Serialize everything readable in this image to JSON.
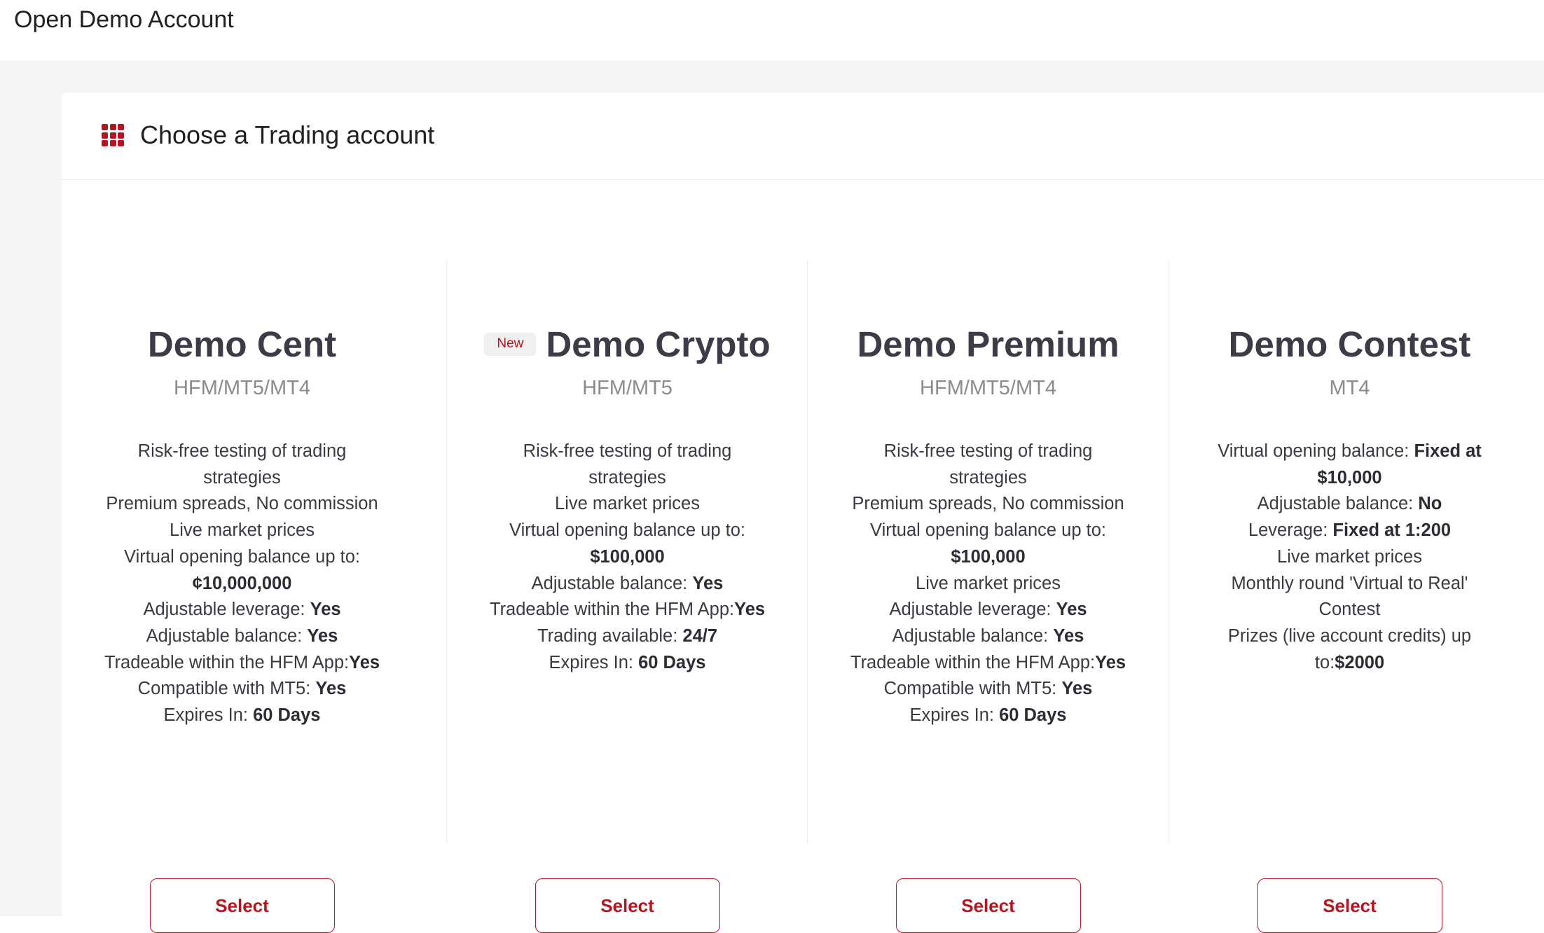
{
  "header": {
    "title": "Open Demo Account"
  },
  "panel": {
    "title": "Choose a Trading account",
    "icon": "grid-apps-icon",
    "accent_color": "#b8131f"
  },
  "cards": [
    {
      "name": "Demo Cent",
      "platform": "HFM/MT5/MT4",
      "lines": [
        {
          "text": "Risk-free testing of trading",
          "bold": ""
        },
        {
          "text": "strategies",
          "bold": ""
        },
        {
          "text": "Premium spreads, No commission",
          "bold": ""
        },
        {
          "text": "Live market prices",
          "bold": ""
        },
        {
          "text": "Virtual opening balance up to:",
          "bold": ""
        },
        {
          "text": "",
          "bold": "¢10,000,000"
        },
        {
          "text": "Adjustable leverage: ",
          "bold": "Yes"
        },
        {
          "text": "Adjustable balance: ",
          "bold": "Yes"
        },
        {
          "text": "Tradeable within the HFM App:",
          "bold": "Yes"
        },
        {
          "text": "Compatible with MT5: ",
          "bold": "Yes"
        },
        {
          "text": "Expires In: ",
          "bold": "60 Days"
        }
      ],
      "button": "Select"
    },
    {
      "badge": "New",
      "name": "Demo Crypto",
      "platform": "HFM/MT5",
      "lines": [
        {
          "text": "Risk-free testing of trading",
          "bold": ""
        },
        {
          "text": "strategies",
          "bold": ""
        },
        {
          "text": "Live market prices",
          "bold": ""
        },
        {
          "text": "Virtual opening balance up to:",
          "bold": ""
        },
        {
          "text": "",
          "bold": "$100,000"
        },
        {
          "text": "Adjustable balance: ",
          "bold": "Yes"
        },
        {
          "text": "Tradeable within the HFM App:",
          "bold": "Yes"
        },
        {
          "text": "Trading available: ",
          "bold": "24/7"
        },
        {
          "text": "Expires In: ",
          "bold": "60 Days"
        }
      ],
      "button": "Select"
    },
    {
      "name": "Demo Premium",
      "platform": "HFM/MT5/MT4",
      "lines": [
        {
          "text": "Risk-free testing of trading",
          "bold": ""
        },
        {
          "text": "strategies",
          "bold": ""
        },
        {
          "text": "Premium spreads, No commission",
          "bold": ""
        },
        {
          "text": "Virtual opening balance up to:",
          "bold": ""
        },
        {
          "text": "",
          "bold": "$100,000"
        },
        {
          "text": "Live market prices",
          "bold": ""
        },
        {
          "text": "Adjustable leverage: ",
          "bold": "Yes"
        },
        {
          "text": "Adjustable balance: ",
          "bold": "Yes"
        },
        {
          "text": "Tradeable within the HFM App:",
          "bold": "Yes"
        },
        {
          "text": "Compatible with MT5: ",
          "bold": "Yes"
        },
        {
          "text": "Expires In: ",
          "bold": "60 Days"
        }
      ],
      "button": "Select"
    },
    {
      "name": "Demo Contest",
      "platform": "MT4",
      "lines": [
        {
          "text": "Virtual opening balance: ",
          "bold": "Fixed at"
        },
        {
          "text": "",
          "bold": "$10,000"
        },
        {
          "text": "Adjustable balance: ",
          "bold": "No"
        },
        {
          "text": "Leverage: ",
          "bold": "Fixed at 1:200"
        },
        {
          "text": "Live market prices",
          "bold": ""
        },
        {
          "text": "Monthly round 'Virtual to Real'",
          "bold": ""
        },
        {
          "text": "Contest",
          "bold": ""
        },
        {
          "text": "Prizes (live account credits) up",
          "bold": ""
        },
        {
          "text": "to:",
          "bold": "$2000"
        }
      ],
      "button": "Select"
    }
  ]
}
